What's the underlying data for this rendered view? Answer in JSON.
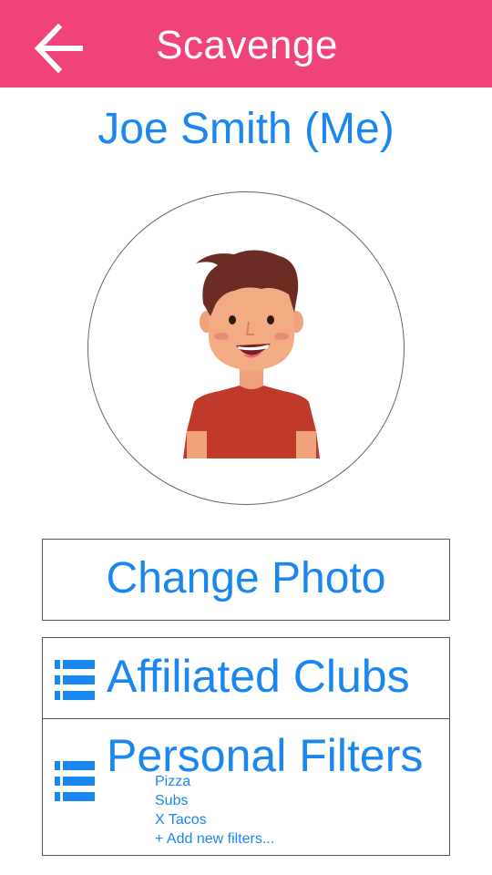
{
  "header": {
    "title": "Scavenge",
    "back_icon": "arrow-left-icon",
    "background_color": "#ef4379"
  },
  "profile": {
    "name": "Joe Smith (Me)",
    "avatar_icon": "cartoon-man-avatar"
  },
  "buttons": {
    "change_photo": "Change Photo"
  },
  "sections": {
    "affiliated_clubs": {
      "label": "Affiliated Clubs",
      "icon": "list-icon"
    },
    "personal_filters": {
      "label": "Personal Filters",
      "icon": "list-icon",
      "items": [
        "Pizza",
        "Subs",
        "X Tacos"
      ],
      "add_label": "+ Add new filters..."
    }
  },
  "colors": {
    "accent": "#1a86f0",
    "header": "#ef4379"
  }
}
